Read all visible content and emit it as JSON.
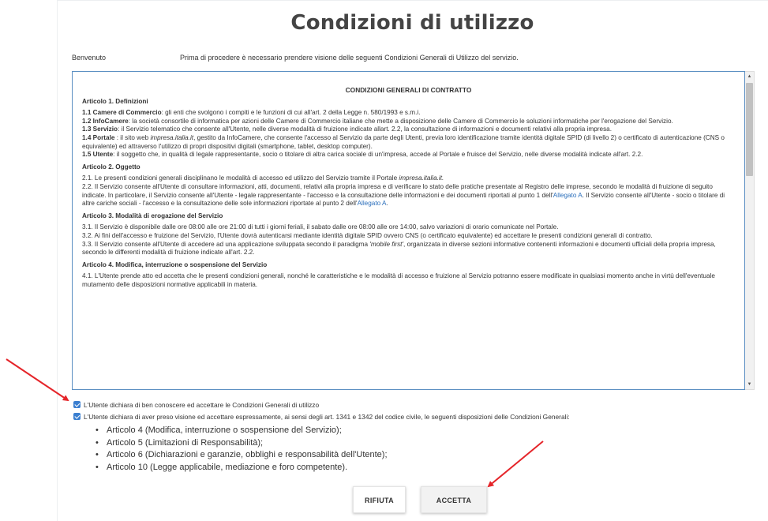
{
  "page": {
    "title": "Condizioni di utilizzo",
    "welcome_label": "Benvenuto",
    "welcome_text": "Prima di procedere è necessario prendere visione delle seguenti Condizioni Generali di Utilizzo del servizio."
  },
  "terms": {
    "heading": "CONDIZIONI GENERALI DI CONTRATTO",
    "art1_title": "Articolo 1. Definizioni",
    "art1_1_term": "1.1 Camere di Commercio",
    "art1_1_text": ": gli enti che svolgono i compiti e le funzioni di cui all'art. 2 della Legge n. 580/1993 e s.m.i.",
    "art1_2_term": "1.2 InfoCamere",
    "art1_2_text": ": la società consortile di informatica per azioni delle Camere di Commercio italiane che mette a disposizione delle Camere di Commercio le soluzioni informatiche per l'erogazione del Servizio.",
    "art1_3_term": "1.3 Servizio",
    "art1_3_text": ": il Servizio telematico che consente all'Utente, nelle diverse modalità di fruizione indicate allart. 2.2, la consultazione di informazioni e documenti relativi alla propria impresa.",
    "art1_4_term": "1.4 Portale",
    "art1_4_pre": " : il sito web ",
    "art1_4_site": "impresa.italia.it",
    "art1_4_text": ", gestito da InfoCamere, che consente l'accesso al Servizio da parte degli Utenti, previa loro identificazione tramite identità digitale SPID (di livello 2) o certificato di autenticazione (CNS o equivalente) ed attraverso l'utilizzo di propri dispositivi digitali (smartphone, tablet, desktop computer).",
    "art1_5_term": "1.5 Utente",
    "art1_5_text": ": il soggetto che, in qualità di legale rappresentante, socio o titolare di altra carica sociale di un'impresa, accede al Portale e fruisce del Servizio, nelle diverse modalità indicate all'art. 2.2.",
    "art2_title": "Articolo 2. Oggetto",
    "art2_1_text": "2.1. Le presenti condizioni generali disciplinano le modalità di accesso ed utilizzo del Servizio tramite il Portale ",
    "art2_1_site": "impresa.italia.it.",
    "art2_2_text_a": "2.2. Il Servizio consente all'Utente di consultare informazioni, atti, documenti, relativi alla propria impresa e di verificare lo stato delle pratiche presentate al Registro delle imprese, secondo le modalità di fruizione di seguito indicate. In particolare, il Servizio consente all'Utente - legale rappresentante - l'accesso e la consultazione delle informazioni e dei documenti riportati al punto 1 dell'",
    "art2_2_link_a": "Allegato A",
    "art2_2_text_b": ". Il Servizio consente all'Utente - socio o titolare di altre cariche sociali - l'accesso e la consultazione delle sole informazioni riportate al punto 2 dell'",
    "art2_2_link_b": "Allegato A",
    "art2_2_end": ".",
    "art3_title": "Articolo 3. Modalità di erogazione del Servizio",
    "art3_1_text": "3.1. Il Servizio è disponibile dalle ore 08:00 alle ore 21:00 di tutti i giorni feriali, il sabato dalle ore 08:00 alle ore 14:00, salvo variazioni di orario comunicate nel Portale.",
    "art3_2_text": "3.2. Ai fini dell'accesso e fruizione del Servizio, l'Utente dovrà autenticarsi mediante identità digitale SPID ovvero CNS (o certificato equivalente) ed accettare le presenti condizioni generali di contratto.",
    "art3_3_pre": "3.3. Il Servizio consente all'Utente di accedere ad una applicazione sviluppata secondo il paradigma ",
    "art3_3_em": "'mobile first'",
    "art3_3_text": ", organizzata in diverse sezioni informative contenenti informazioni e documenti ufficiali della propria impresa, secondo le differenti modalità di fruizione indicate all'art. 2.2.",
    "art4_title": "Articolo 4. Modifica, interruzione o sospensione del Servizio",
    "art4_1_text": "4.1. L'Utente prende atto ed accetta che le presenti condizioni generali, nonché le caratteristiche e le modalità di accesso e fruizione al Servizio potranno essere modificate in qualsiasi momento anche in virtù dell'eventuale mutamento delle disposizioni normative applicabili in materia."
  },
  "consent": {
    "checkbox1_label": "L'Utente dichiara di ben conoscere ed accettare le Condizioni Generali di utilizzo",
    "checkbox2_label": "L'Utente dichiara di aver preso visione ed accettare espressamente, ai sensi degli art. 1341 e 1342 del codice civile, le seguenti disposizioni delle Condizioni Generali:",
    "items": [
      "Articolo 4 (Modifica, interruzione o sospensione del Servizio);",
      "Articolo 5 (Limitazioni di Responsabilità);",
      "Articolo 6 (Dichiarazioni e garanzie, obblighi e responsabilità dell'Utente);",
      "Articolo 10 (Legge applicabile, mediazione e foro competente)."
    ]
  },
  "buttons": {
    "reject": "RIFIUTA",
    "accept": "ACCETTA"
  },
  "colors": {
    "checkbox": "#3b7fd0",
    "link": "#2a6ebb",
    "box_border": "#5b8fc2",
    "annotation_arrow": "#e5252a"
  }
}
